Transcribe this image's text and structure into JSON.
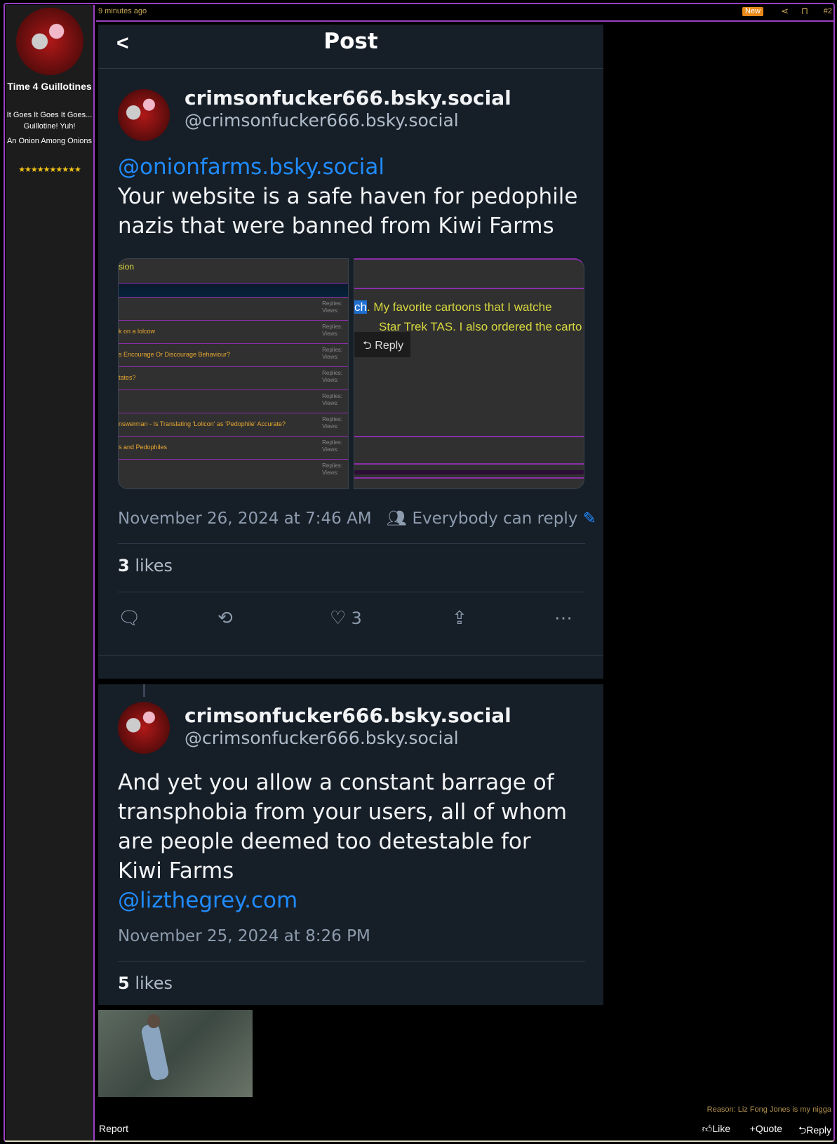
{
  "sidebar": {
    "username": "Time 4 Guillotines",
    "user_title": "It Goes It Goes It Goes... Guillotine! Yuh!",
    "rank": "An Onion Among Onions",
    "stars": "★★★★★★★★★★"
  },
  "topbar": {
    "time": "9 minutes ago",
    "new_badge": "New",
    "post_number": "#2"
  },
  "panel": {
    "title": "Post"
  },
  "post1": {
    "name": "crimsonfucker666.bsky.social",
    "handle": "@crimsonfucker666.bsky.social",
    "mention": "@onionfarms.bsky.social",
    "text": "Your website is a safe haven for pedophile nazis that were banned from Kiwi Farms",
    "date": "November 26, 2024 at 7:46 AM",
    "reply_setting": "Everybody can reply",
    "likes_count": "3",
    "likes_label": "likes",
    "heart_count": "3",
    "image1": {
      "heading": "sion",
      "rows": [
        {
          "title": "",
          "replies": "Replies:",
          "views": "Views:"
        },
        {
          "title": "k on a lolcow",
          "replies": "Replies:",
          "views": "Views:"
        },
        {
          "title": "s Encourage Or Discourage Behaviour?",
          "replies": "Replies:",
          "views": "Views:"
        },
        {
          "title": "tates?",
          "replies": "Replies:",
          "views": "Views:"
        },
        {
          "title": "",
          "replies": "Replies:",
          "views": "Views:"
        },
        {
          "title": "nswerman - Is Translating 'Lolicon' as 'Pedophile' Accurate?",
          "replies": "Replies:",
          "views": "Views:"
        },
        {
          "title": "s and Pedophiles",
          "replies": "Replies:",
          "views": "Views:"
        },
        {
          "title": "",
          "replies": "Replies:",
          "views": "Views:"
        }
      ]
    },
    "image2": {
      "highlight": "ch",
      "line1": ". My favorite cartoons that I watche",
      "line2": "Star Trek TAS. I also ordered the carto",
      "reply_label": "Reply"
    }
  },
  "post2": {
    "name": "crimsonfucker666.bsky.social",
    "handle": "@crimsonfucker666.bsky.social",
    "text": "And yet you allow a constant barrage of transphobia from your users, all of whom are people deemed too detestable for Kiwi Farms",
    "mention": "@lizthegrey.com",
    "date": "November 25, 2024 at 8:26 PM",
    "likes_count": "5",
    "likes_label": "likes"
  },
  "footer": {
    "reason": "Reason: Liz Fong Jones is my nigga",
    "report": "Report",
    "like": "Like",
    "quote": "Quote",
    "reply": "Reply"
  },
  "colors": {
    "accent": "#9b3fc4",
    "link": "#208bfe",
    "new_badge": "#e8891a"
  }
}
